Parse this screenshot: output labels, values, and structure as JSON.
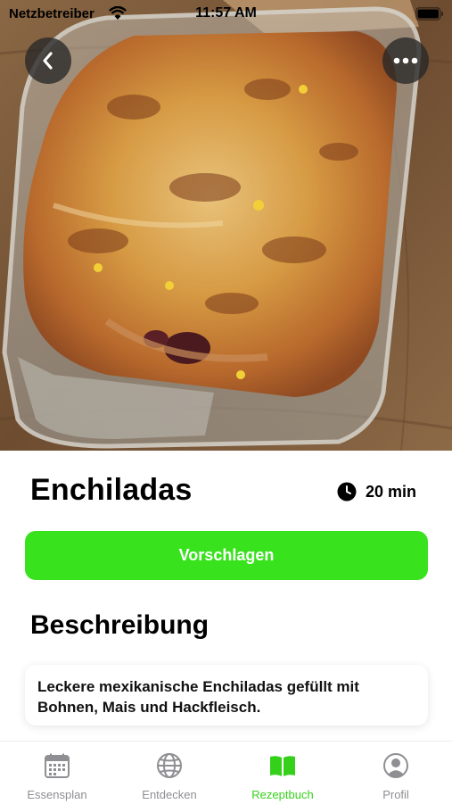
{
  "status_bar": {
    "carrier": "Netzbetreiber",
    "time": "11:57 AM"
  },
  "hero": {
    "image_alt": "Enchiladas in Auflaufform"
  },
  "recipe": {
    "title": "Enchiladas",
    "duration": "20 min",
    "suggest_label": "Vorschlagen",
    "description_heading": "Beschreibung",
    "description": "Leckere mexikanische Enchiladas gefüllt mit Bohnen, Mais und Hackfleisch."
  },
  "tabbar": {
    "items": [
      {
        "label": "Essensplan",
        "icon": "calendar-icon"
      },
      {
        "label": "Entdecken",
        "icon": "globe-icon"
      },
      {
        "label": "Rezeptbuch",
        "icon": "book-icon",
        "active": true
      },
      {
        "label": "Profil",
        "icon": "person-icon"
      }
    ]
  },
  "colors": {
    "accent": "#38e21d",
    "tab_active": "#35d11a",
    "tab_inactive": "#8e8e93",
    "hero_button_bg": "#282828"
  }
}
